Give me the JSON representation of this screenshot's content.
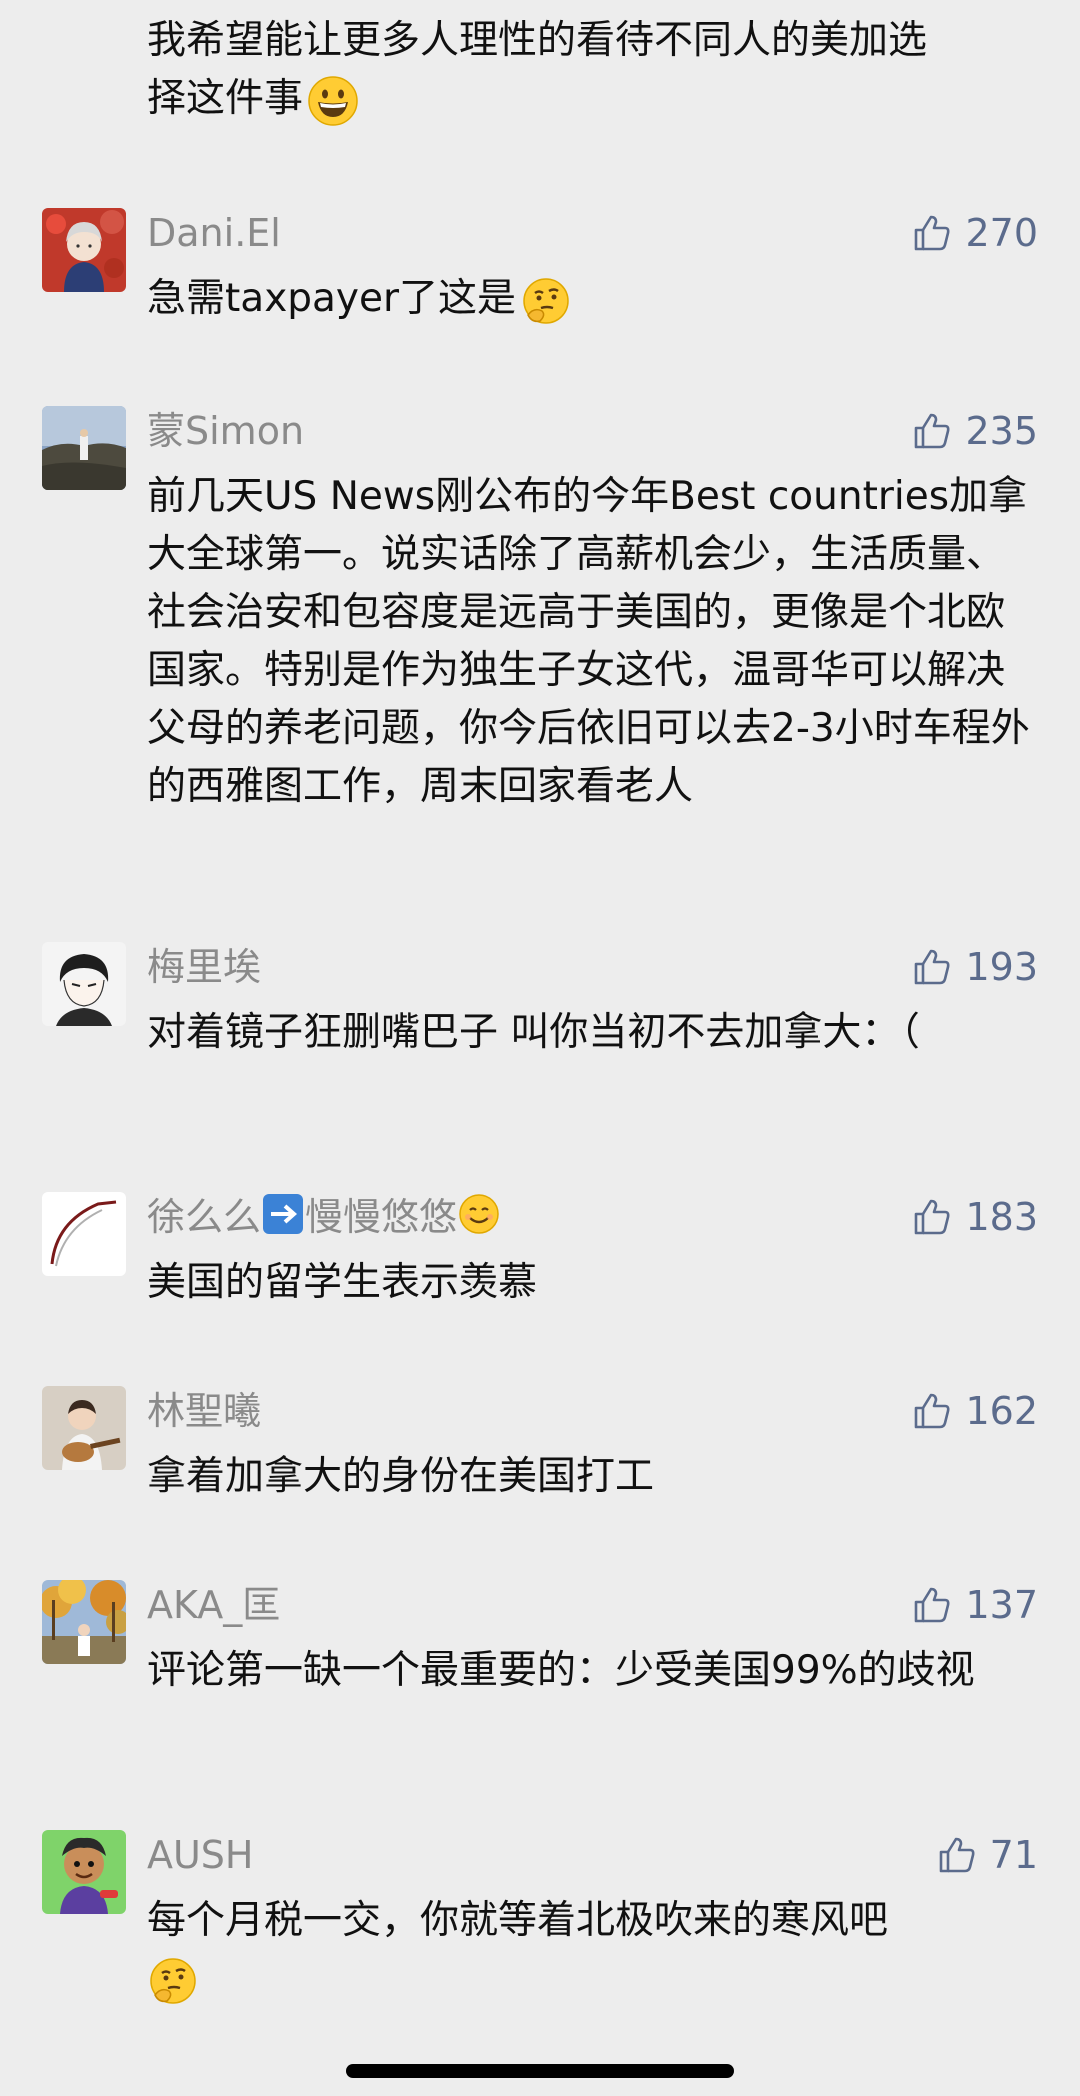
{
  "top_comment": {
    "line1": "我希望能让更多人理性的看待不同人的美加选",
    "line2": "择这件事",
    "emoji": "grinning-face-emoji"
  },
  "comments": [
    {
      "name": "Dani.El",
      "likes": "270",
      "text": "急需taxpayer了这是",
      "emoji": "thinking-face-emoji",
      "avatar": "anime-boy-red-background"
    },
    {
      "name": "蒙Simon",
      "likes": "235",
      "text": "前几天US News刚公布的今年Best countries加拿大全球第一。说实话除了高薪机会少，生活质量、社会治安和包容度是远高于美国的，更像是个北欧国家。特别是作为独生子女这代，温哥华可以解决父母的养老问题，你今后依旧可以去2-3小时车程外的西雅图工作，周末回家看老人",
      "avatar": "person-landscape"
    },
    {
      "name": "梅里埃",
      "likes": "193",
      "text": "对着镜子狂删嘴巴子 叫你当初不去加拿大：（",
      "avatar": "anime-sketch"
    },
    {
      "name": "徐么么",
      "name_suffix": "慢慢悠悠",
      "name_icons": [
        "right-arrow-icon",
        "smiling-face-emoji"
      ],
      "likes": "183",
      "text": "美国的留学生表示羡慕",
      "avatar": "swoosh-drawing"
    },
    {
      "name": "林聖曦",
      "likes": "162",
      "text": "拿着加拿大的身份在美国打工",
      "avatar": "child-guitar"
    },
    {
      "name": "AKA_匡",
      "likes": "137",
      "text": "评论第一缺一个最重要的：少受美国99%的歧视",
      "avatar": "autumn-trees"
    },
    {
      "name": "AUSH",
      "likes": "71",
      "text": "每个月税一交，你就等着北极吹来的寒风吧",
      "emoji": "thinking-face-emoji",
      "avatar": "cartoon-character-green"
    }
  ],
  "colors": {
    "background": "#ededed",
    "name": "#8a8a8a",
    "like": "#5b6b8c",
    "text": "#111111"
  }
}
